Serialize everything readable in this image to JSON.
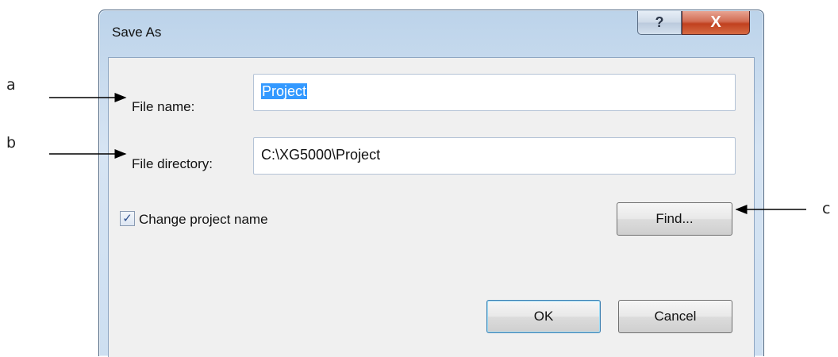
{
  "callouts": {
    "a": "a",
    "b": "b",
    "c": "c"
  },
  "dialog": {
    "title": "Save As",
    "help_glyph": "?",
    "close_glyph": "X",
    "file_name_label": "File name:",
    "file_name_value": "Project",
    "file_directory_label": "File directory:",
    "file_directory_value": "C:\\XG5000\\Project",
    "change_project_name_label": "Change project name",
    "change_project_name_checked": true,
    "find_button": "Find...",
    "ok_button": "OK",
    "cancel_button": "Cancel"
  },
  "icons": {
    "help": "help-icon",
    "close": "close-icon",
    "check": "checkmark-icon"
  }
}
